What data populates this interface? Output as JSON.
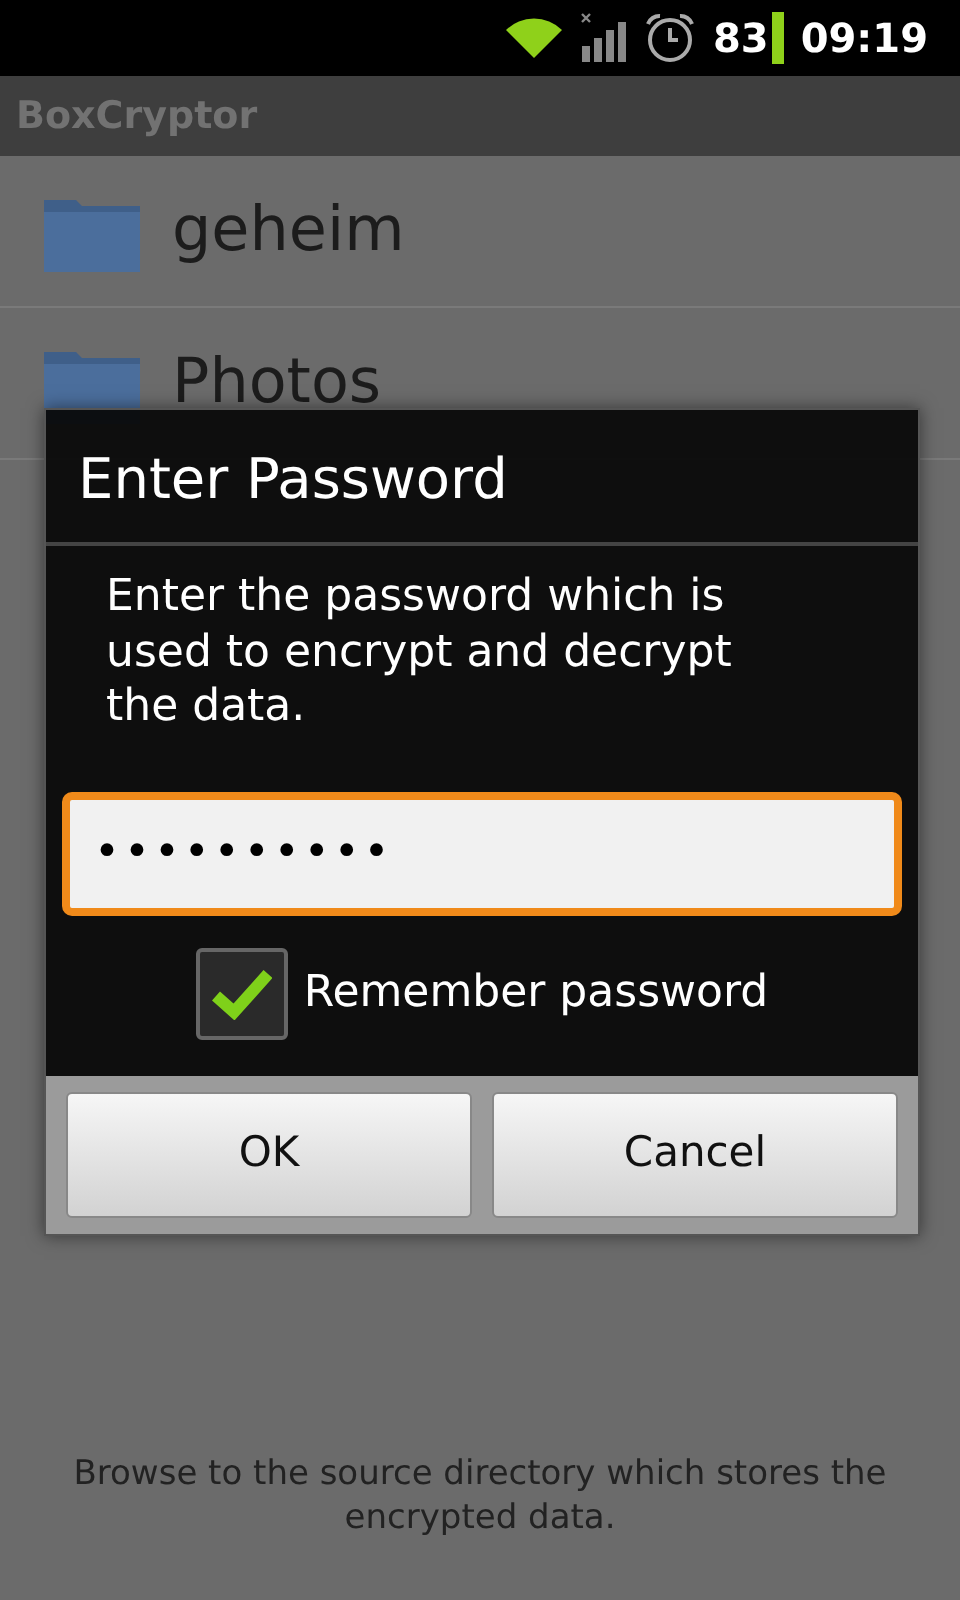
{
  "status_bar": {
    "battery": "83",
    "time": "09:19"
  },
  "app_bar": {
    "title": "BoxCryptor"
  },
  "folders": [
    {
      "name": "geheim"
    },
    {
      "name": "Photos"
    }
  ],
  "hint": "Browse to the source directory which stores the encrypted data.",
  "dialog": {
    "title": "Enter Password",
    "message": "Enter the password which is used to encrypt and decrypt the data.",
    "password": "••••••••••",
    "remember": {
      "label": "Remember password",
      "checked": true
    },
    "buttons": [
      "OK",
      "Cancel"
    ]
  }
}
